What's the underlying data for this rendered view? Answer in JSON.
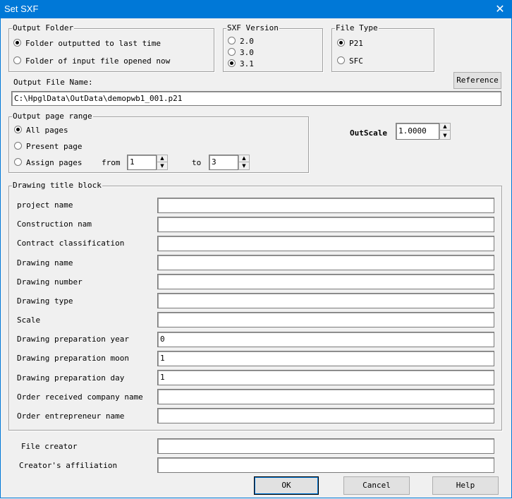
{
  "window": {
    "title": "Set SXF",
    "close_glyph": "✕"
  },
  "output_folder": {
    "legend": "Output Folder",
    "options": [
      {
        "label": "Folder outputted to last time",
        "selected": true
      },
      {
        "label": "Folder of input file opened now",
        "selected": false
      }
    ]
  },
  "sxf_version": {
    "legend": "SXF Version",
    "options": [
      {
        "label": "2.0",
        "selected": false
      },
      {
        "label": "3.0",
        "selected": false
      },
      {
        "label": "3.1",
        "selected": true
      }
    ]
  },
  "file_type": {
    "legend": "File Type",
    "options": [
      {
        "label": "P21",
        "selected": true
      },
      {
        "label": "SFC",
        "selected": false
      }
    ]
  },
  "output_file": {
    "label": "Output File Name:",
    "value": "C:\\HpglData\\OutData\\demopwb1_001.p21",
    "reference_label": "Reference"
  },
  "page_range": {
    "legend": "Output page range",
    "options": [
      {
        "label": "All pages",
        "selected": true
      },
      {
        "label": "Present page",
        "selected": false
      },
      {
        "label": "Assign pages",
        "selected": false
      }
    ],
    "from_label": "from",
    "from_value": "1",
    "to_label": "to",
    "to_value": "3"
  },
  "outscale": {
    "label": "OutScale",
    "value": "1.0000"
  },
  "title_block": {
    "legend": "Drawing title block",
    "rows": [
      {
        "label": "project name",
        "value": ""
      },
      {
        "label": "Construction nam",
        "value": ""
      },
      {
        "label": "Contract classification",
        "value": ""
      },
      {
        "label": "Drawing name",
        "value": ""
      },
      {
        "label": "Drawing number",
        "value": ""
      },
      {
        "label": "Drawing type",
        "value": ""
      },
      {
        "label": "Scale",
        "value": ""
      },
      {
        "label": "Drawing preparation year",
        "value": "0"
      },
      {
        "label": "Drawing preparation moon",
        "value": "1"
      },
      {
        "label": "Drawing preparation day",
        "value": "1"
      },
      {
        "label": "Order received company name",
        "value": ""
      },
      {
        "label": "Order entrepreneur name",
        "value": ""
      }
    ]
  },
  "creator": {
    "file_creator_label": "File creator",
    "file_creator_value": "",
    "affiliation_label": "Creator's affiliation",
    "affiliation_value": ""
  },
  "buttons": {
    "ok": "OK",
    "cancel": "Cancel",
    "help": "Help"
  },
  "icons": {
    "up": "▲",
    "down": "▼"
  }
}
